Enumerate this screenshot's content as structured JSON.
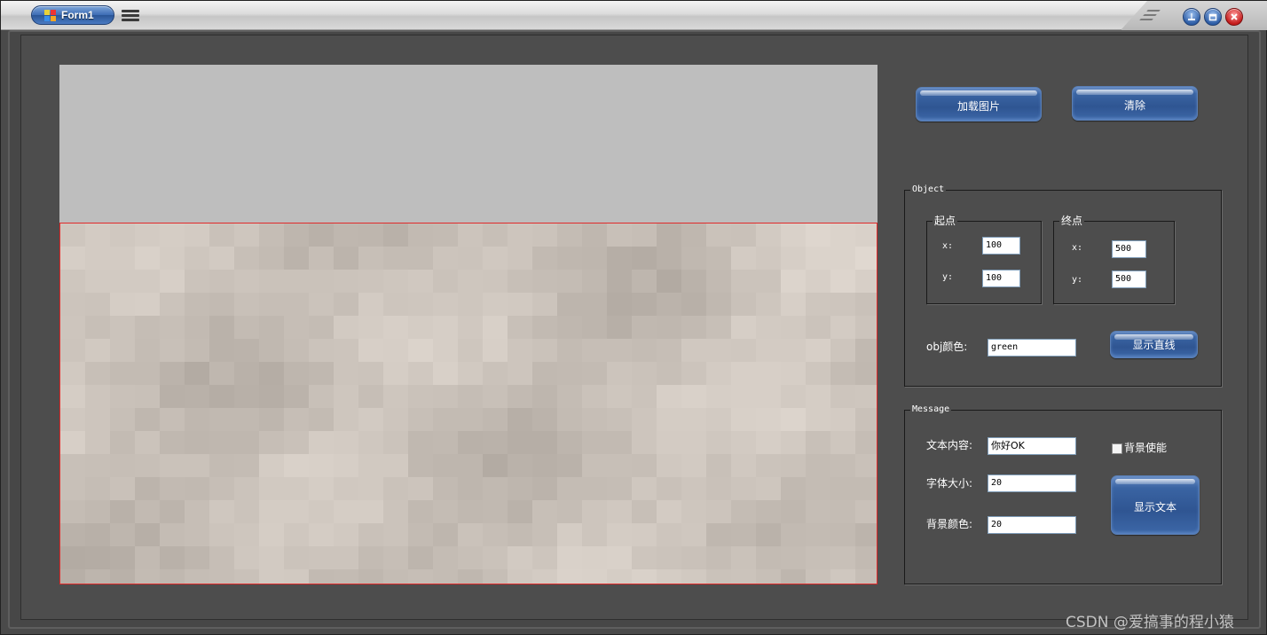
{
  "window": {
    "title": "Form1"
  },
  "toolbar": {
    "load_image_label": "加载图片",
    "clear_label": "清除"
  },
  "object_group": {
    "title": "Object",
    "start": {
      "title": "起点",
      "x_label": "x:",
      "x_value": "100",
      "y_label": "y:",
      "y_value": "100"
    },
    "end": {
      "title": "终点",
      "x_label": "x:",
      "x_value": "500",
      "y_label": "y:",
      "y_value": "500"
    },
    "color_label": "obj颜色:",
    "color_value": "green",
    "show_line_label": "显示直线"
  },
  "message_group": {
    "title": "Message",
    "text_label": "文本内容:",
    "text_value": "你好OK",
    "font_size_label": "字体大小:",
    "font_size_value": "20",
    "bg_color_label": "背景颜色:",
    "bg_color_value": "20",
    "bg_enable_label": "背景使能",
    "bg_enable_checked": false,
    "show_text_label": "显示文本"
  },
  "watermark": "CSDN @爱搞事的程小猿",
  "colors": {
    "client_bg": "#4d4d4d",
    "picture_border": "#e02a2a",
    "button_blue": "#2f5592",
    "picture_placeholder": "#bebebe"
  },
  "icons": {
    "app": "app-icon",
    "menu": "menu-icon",
    "minimize": "minimize-icon",
    "restore": "restore-icon",
    "close": "close-icon"
  }
}
